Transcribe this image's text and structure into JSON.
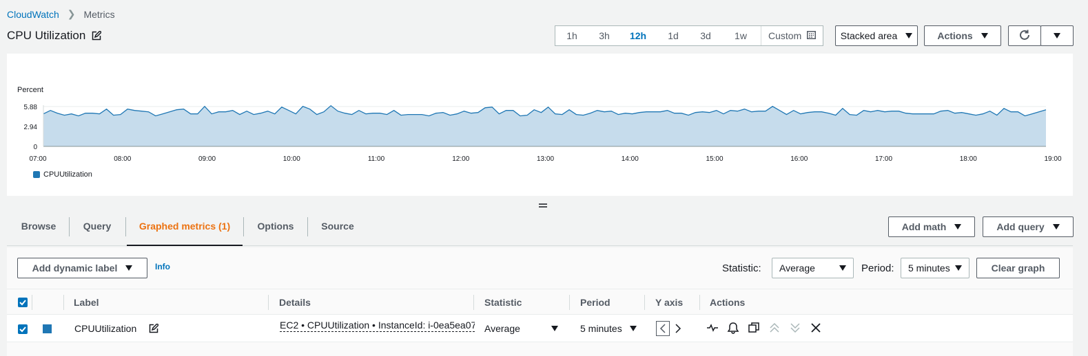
{
  "breadcrumb": {
    "root": "CloudWatch",
    "current": "Metrics"
  },
  "page": {
    "title": "CPU Utilization"
  },
  "time_range": {
    "options": [
      "1h",
      "3h",
      "12h",
      "1d",
      "3d",
      "1w"
    ],
    "active": "12h",
    "custom_label": "Custom"
  },
  "toolbar": {
    "chart_type": "Stacked area",
    "actions_label": "Actions"
  },
  "colors": {
    "series": "#1f77b4",
    "area_fill": "#c6dcec",
    "accent": "#ec7211",
    "link": "#0073bb"
  },
  "chart_data": {
    "type": "area",
    "ylabel": "Percent",
    "yticks": [
      "0",
      "2.94",
      "5.88"
    ],
    "ylim": [
      0,
      5.88
    ],
    "xticks": [
      "07:00",
      "08:00",
      "09:00",
      "10:00",
      "11:00",
      "12:00",
      "13:00",
      "14:00",
      "15:00",
      "16:00",
      "17:00",
      "18:00",
      "19:00"
    ],
    "x_start": "07:00",
    "x_end": "19:00",
    "grid": true,
    "legend_position": "bottom-left",
    "series": [
      {
        "name": "CPUUtilization",
        "values": [
          4.8,
          5.3,
          4.9,
          4.6,
          4.8,
          4.5,
          4.9,
          4.9,
          4.8,
          5.5,
          4.6,
          4.7,
          5.5,
          5.3,
          5.2,
          5.1,
          4.5,
          4.8,
          5.1,
          5.4,
          5.5,
          4.8,
          4.8,
          5.9,
          4.8,
          5.1,
          5.1,
          5.3,
          4.7,
          5.2,
          4.7,
          4.9,
          5.2,
          4.8,
          5.8,
          5.3,
          4.8,
          5.9,
          5.5,
          4.7,
          5.1,
          6.0,
          5.2,
          4.9,
          4.7,
          5.3,
          4.8,
          4.9,
          4.9,
          4.7,
          5.3,
          4.6,
          4.7,
          4.7,
          4.7,
          4.5,
          4.9,
          5.0,
          4.6,
          4.8,
          5.2,
          4.9,
          5.0,
          5.7,
          5.8,
          4.8,
          5.3,
          5.3,
          4.5,
          4.6,
          5.4,
          5.0,
          5.8,
          4.8,
          4.7,
          5.4,
          4.7,
          4.6,
          4.9,
          5.3,
          5.1,
          5.2,
          4.7,
          4.9,
          4.8,
          5.0,
          5.1,
          5.1,
          5.1,
          5.3,
          4.9,
          4.9,
          4.6,
          5.0,
          5.1,
          5.0,
          5.3,
          4.8,
          5.3,
          5.2,
          5.5,
          5.1,
          5.2,
          5.2,
          5.9,
          5.3,
          4.7,
          5.3,
          4.8,
          5.0,
          5.1,
          5.1,
          4.9,
          4.6,
          5.6,
          4.7,
          4.6,
          5.3,
          5.1,
          5.3,
          5.1,
          5.2,
          5.2,
          4.9,
          4.8,
          4.8,
          4.8,
          4.8,
          5.2,
          5.3,
          4.9,
          5.0,
          4.8,
          4.6,
          4.8,
          5.2,
          4.6,
          5.6,
          5.1,
          5.1,
          4.5,
          4.8,
          5.1,
          5.4
        ]
      }
    ]
  },
  "tabs": [
    {
      "label": "Browse"
    },
    {
      "label": "Query"
    },
    {
      "label": "Graphed metrics (1)"
    },
    {
      "label": "Options"
    },
    {
      "label": "Source"
    }
  ],
  "tab_actions": {
    "add_math": "Add math",
    "add_query": "Add query"
  },
  "metrics_toolbar": {
    "add_dynamic_label": "Add dynamic label",
    "info": "Info",
    "statistic_label": "Statistic:",
    "statistic_value": "Average",
    "period_label": "Period:",
    "period_value": "5 minutes",
    "clear_graph": "Clear graph"
  },
  "table": {
    "headers": {
      "label": "Label",
      "details": "Details",
      "statistic": "Statistic",
      "period": "Period",
      "y_axis": "Y axis",
      "actions": "Actions"
    },
    "rows": [
      {
        "label": "CPUUtilization",
        "details": "EC2 • CPUUtilization • InstanceId: i-0ea5ea07",
        "statistic": "Average",
        "period": "5 minutes"
      }
    ]
  }
}
